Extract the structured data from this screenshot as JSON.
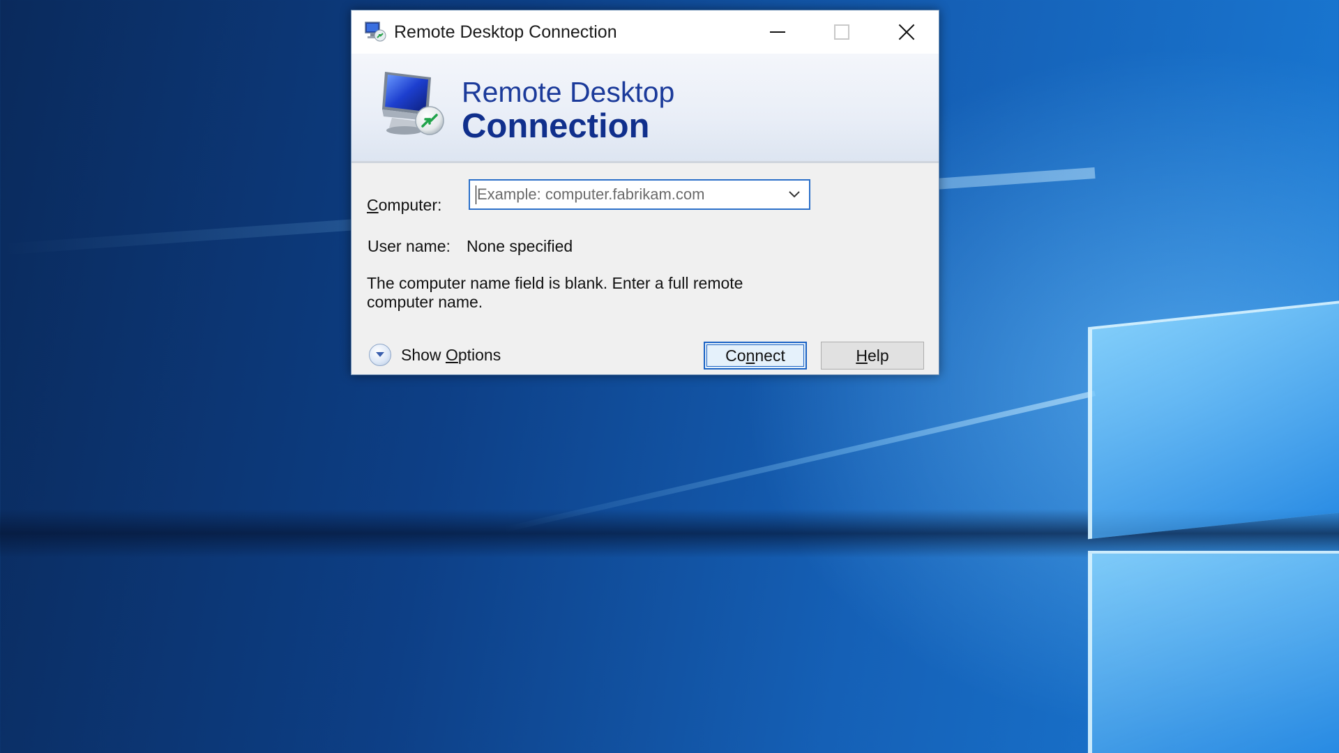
{
  "window": {
    "title": "Remote Desktop Connection",
    "controls": [
      "minimize",
      "maximize",
      "close"
    ]
  },
  "banner": {
    "line1": "Remote Desktop",
    "line2": "Connection",
    "icon": "monitor-remote-icon"
  },
  "form": {
    "computer_label_prefix": "C",
    "computer_label_rest": "omputer:",
    "computer_placeholder": "Example: computer.fabrikam.com",
    "computer_value": "",
    "username_label": "User name:",
    "username_value": "None specified",
    "message": "The computer name field is blank. Enter a full remote computer name."
  },
  "footer": {
    "show_options_prefix": "Show ",
    "show_options_underlined": "O",
    "show_options_rest": "ptions",
    "connect_prefix": "Co",
    "connect_underlined": "n",
    "connect_rest": "nect",
    "help_underlined": "H",
    "help_rest": "elp"
  },
  "colors": {
    "accent": "#1a62c4",
    "banner_text": "#102f8c",
    "dialog_bg": "#f0f0f0",
    "desktop_bg": "#0d3f86"
  }
}
